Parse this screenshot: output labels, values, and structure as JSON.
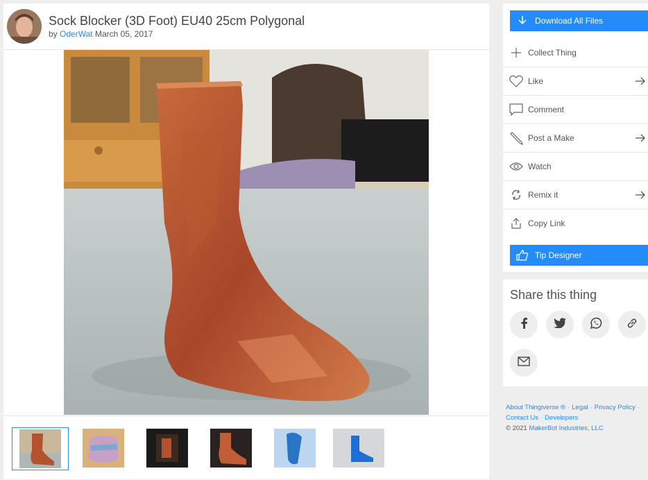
{
  "thing": {
    "title": "Sock Blocker (3D Foot) EU40 25cm Polygonal",
    "by_label": "by",
    "author": "OderWat",
    "date": "March 05, 2017"
  },
  "actions": {
    "download": "Download All Files",
    "collect": "Collect Thing",
    "like": "Like",
    "comment": "Comment",
    "post_make": "Post a Make",
    "watch": "Watch",
    "remix": "Remix it",
    "copy_link": "Copy Link",
    "tip": "Tip Designer"
  },
  "share": {
    "title": "Share this thing",
    "buttons": [
      "facebook-icon",
      "twitter-icon",
      "whatsapp-icon",
      "link-icon",
      "mail-icon"
    ]
  },
  "footer": {
    "about": "About Thingiverse ®",
    "legal": "Legal",
    "privacy": "Privacy Policy",
    "contact": "Contact Us",
    "developers": "Developers",
    "copyright": "© 2021",
    "company": "MakerBot Industries, LLC",
    "separator": "·"
  },
  "colors": {
    "accent": "#248bfb",
    "foot": "#b5522e"
  },
  "thumbnails": [
    "foot-photo",
    "sock-photo",
    "printer-photo",
    "foot-dark-photo",
    "insole-render",
    "blue-foot-render"
  ]
}
